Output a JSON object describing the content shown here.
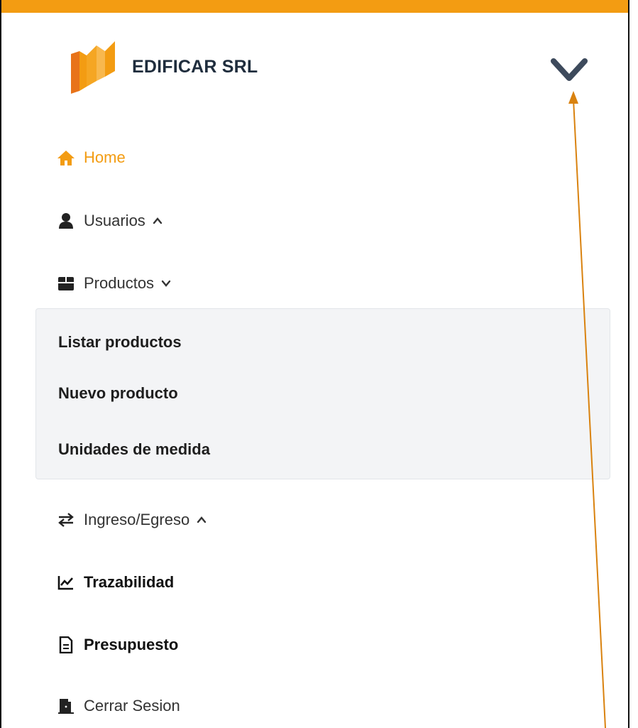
{
  "brand": {
    "name": "EDIFICAR SRL"
  },
  "menu": {
    "home": "Home",
    "usuarios": "Usuarios",
    "productos": "Productos",
    "ingreso_egreso": "Ingreso/Egreso",
    "trazabilidad": "Trazabilidad",
    "presupuesto": "Presupuesto",
    "cerrar_sesion": "Cerrar Sesion"
  },
  "submenu_productos": {
    "listar": "Listar productos",
    "nuevo": "Nuevo producto",
    "unidades": "Unidades de medida"
  },
  "colors": {
    "accent": "#f39c12",
    "arrow": "#d9820f",
    "text": "#333333",
    "submenu_bg": "#f3f4f6"
  },
  "icons": {
    "home": "home-icon",
    "usuarios": "user-icon",
    "productos": "box-icon",
    "ingreso_egreso": "exchange-icon",
    "trazabilidad": "chart-line-icon",
    "presupuesto": "document-icon",
    "cerrar_sesion": "door-icon",
    "toggle": "chevron-down-icon"
  }
}
